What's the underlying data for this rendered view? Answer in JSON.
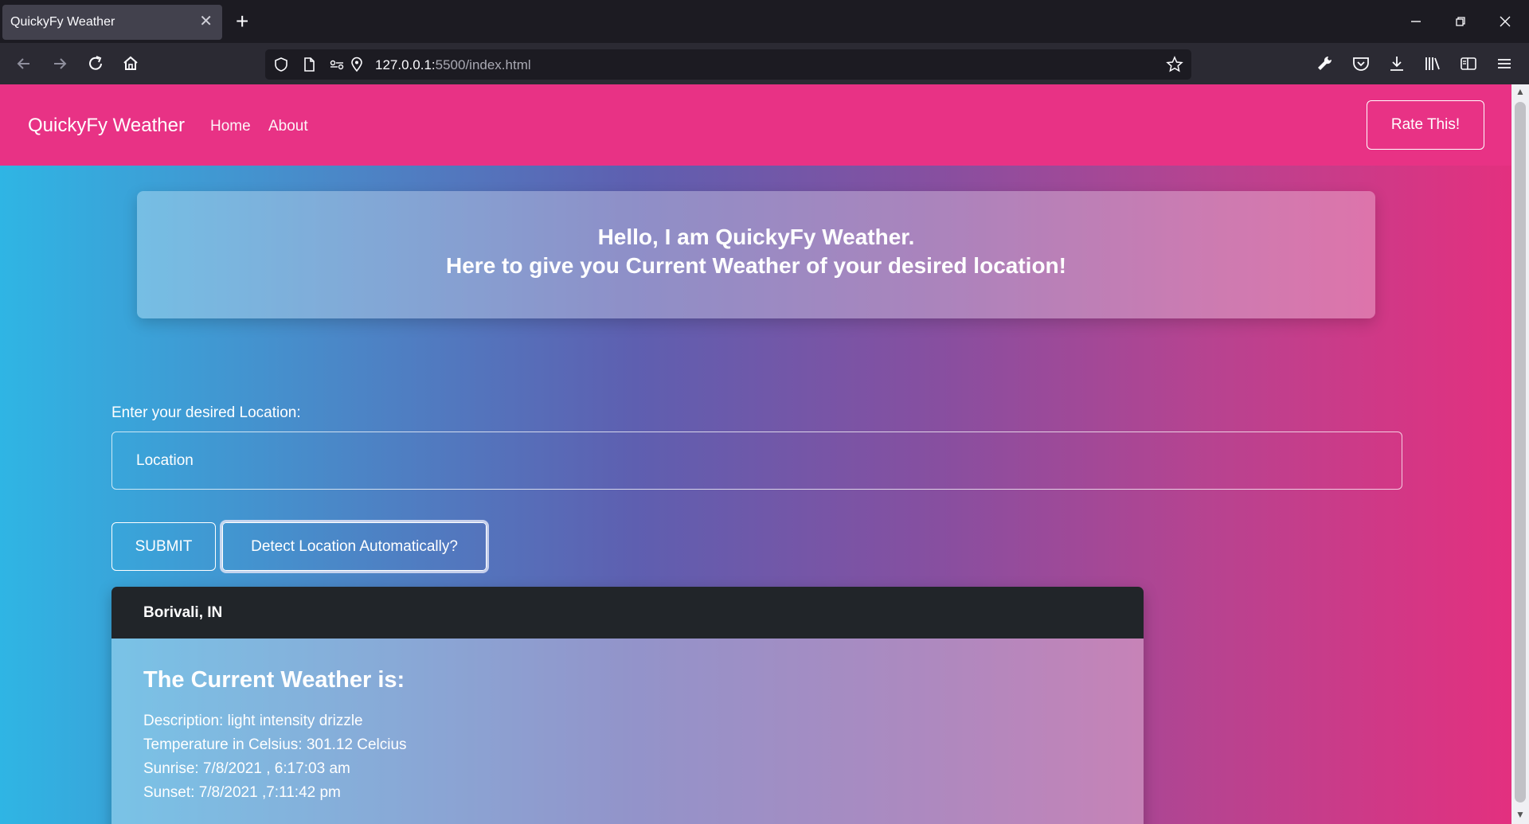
{
  "browser": {
    "tab_title": "QuickyFy Weather",
    "url_host": "127.0.0.1:",
    "url_rest": "5500/index.html"
  },
  "site": {
    "brand": "QuickyFy Weather",
    "nav": [
      "Home",
      "About"
    ],
    "rate_button": "Rate This!"
  },
  "hero": {
    "line1": "Hello, I am QuickyFy Weather.",
    "line2": "Here to give you Current Weather of your desired location!"
  },
  "form": {
    "label": "Enter your desired Location:",
    "placeholder": "Location",
    "submit": "SUBMIT",
    "detect": "Detect Location Automatically?"
  },
  "weather": {
    "location": "Borivali, IN",
    "title": "The Current Weather is:",
    "description": "Description: light intensity drizzle",
    "temperature": "Temperature in Celsius: 301.12 Celcius",
    "sunrise": "Sunrise: 7/8/2021 , 6:17:03 am",
    "sunset": "Sunset: 7/8/2021 ,7:11:42 pm"
  }
}
